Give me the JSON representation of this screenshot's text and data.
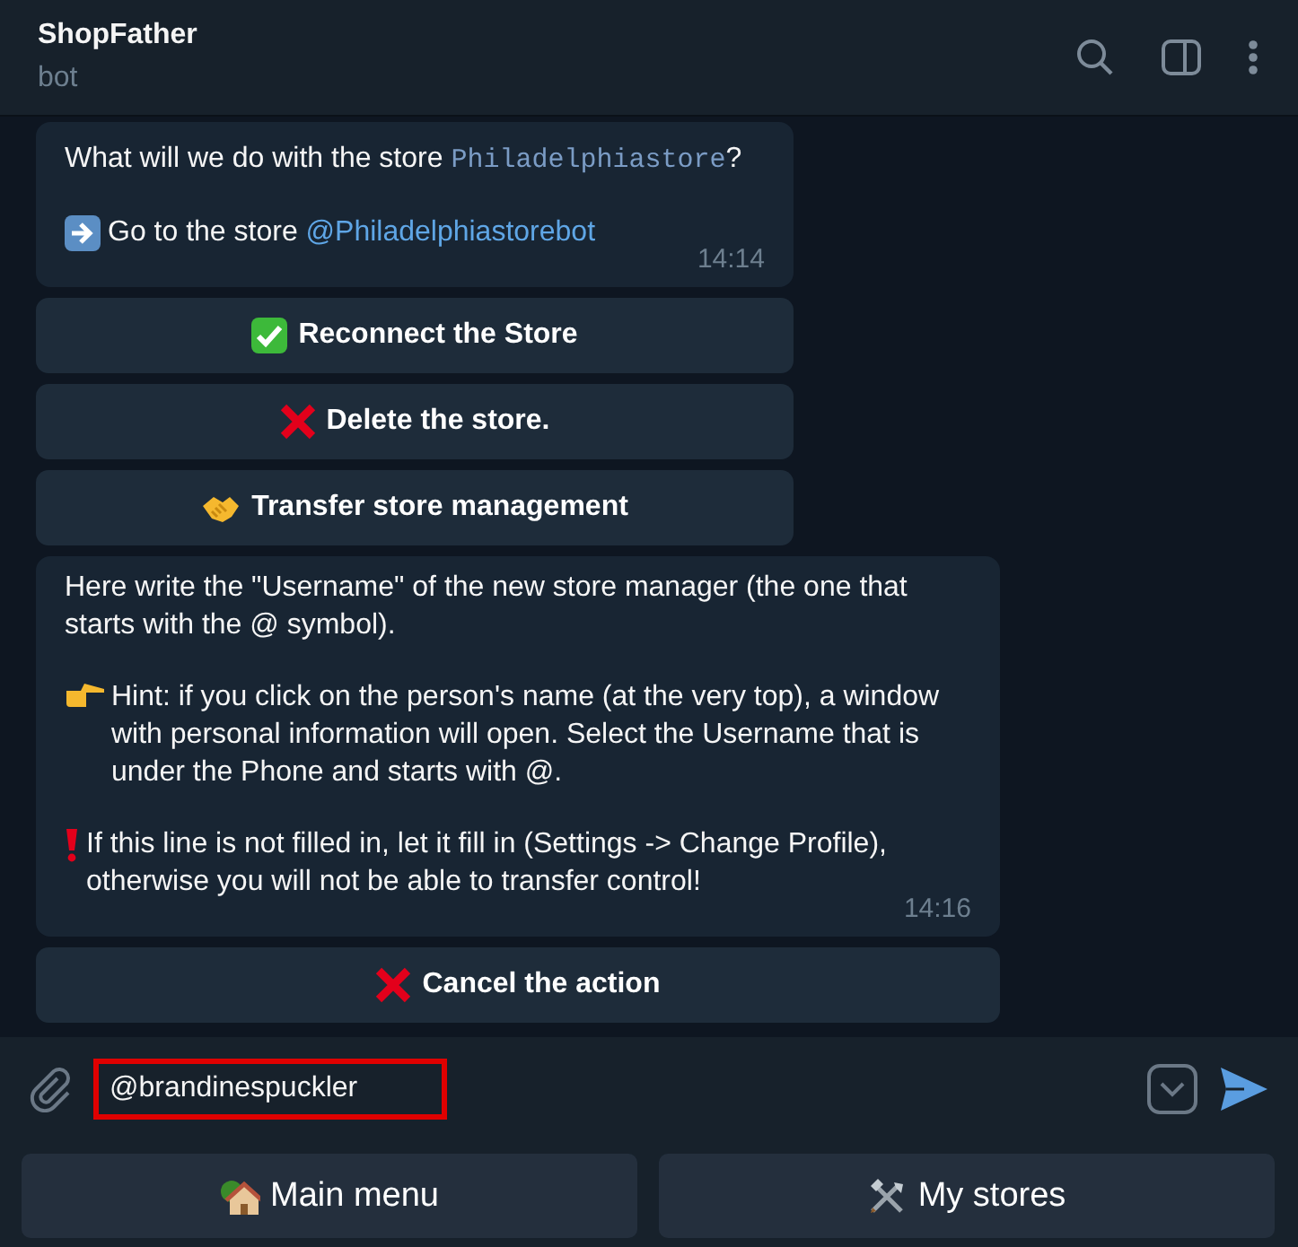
{
  "header": {
    "title": "ShopFather",
    "subtitle": "bot"
  },
  "messages": [
    {
      "paragraphs": [
        {
          "kind": "plain",
          "text": "What will we do with the store ",
          "code": "Philadelphiastore",
          "after": "?"
        },
        {
          "kind": "arrow",
          "text": "Go to the store ",
          "link": "@Philadelphiastorebot"
        }
      ],
      "time": "14:14",
      "wide": false,
      "buttons": [
        {
          "kind": "check",
          "label": "Reconnect the Store"
        },
        {
          "kind": "cross",
          "label": "Delete the store."
        },
        {
          "kind": "handshake",
          "label": "Transfer store management"
        }
      ]
    },
    {
      "paragraphs": [
        {
          "kind": "plain",
          "text": "Here write the \"Username\" of the new store manager (the one that starts with the @ symbol)."
        },
        {
          "kind": "pointing",
          "text": "Hint: if you click on the person's name (at the very top), a window with personal information will open. Select the Username that is under the Phone and starts with @."
        },
        {
          "kind": "exclamation",
          "text": " If this line is not filled in, let it fill in (Settings -> Change Profile), otherwise you will not be able to transfer control!"
        }
      ],
      "time": "14:16",
      "wide": true,
      "buttons": [
        {
          "kind": "cross",
          "label": "Cancel the action"
        }
      ]
    }
  ],
  "composer": {
    "value": "@brandinespuckler",
    "highlighted": true
  },
  "keyboard": [
    {
      "kind": "house",
      "label": "Main menu"
    },
    {
      "kind": "tools",
      "label": "My stores"
    }
  ]
}
